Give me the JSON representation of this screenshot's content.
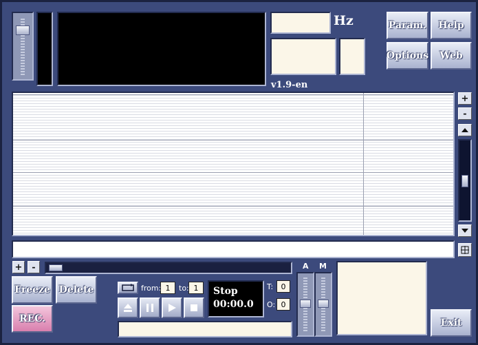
{
  "top": {
    "hz_label": "Hz",
    "version": "v1.9-en",
    "buttons": {
      "param": "Param.",
      "help": "Help",
      "options": "Options",
      "web": "Web"
    }
  },
  "side_controls": {
    "plus": "+",
    "minus": "-"
  },
  "bottom": {
    "plus": "+",
    "minus": "-",
    "freeze": "Freeze",
    "delete": "Delete",
    "rec": "REC.",
    "exit": "Exit",
    "from_label": "from:",
    "from_value": "1",
    "to_label": "to:",
    "to_value": "1",
    "status": "Stop",
    "time": "00:00.0",
    "t_label": "T:",
    "t_value": "0",
    "o_label": "O:",
    "o_value": "0",
    "a_label": "A",
    "m_label": "M"
  },
  "icons": {
    "repeat": "repeat-icon",
    "eject": "eject-icon",
    "pause": "pause-icon",
    "play": "play-icon",
    "stop": "stop-icon",
    "scroll_up": "triangle-up-icon",
    "scroll_down": "triangle-down-icon",
    "fit": "fit-view-icon"
  },
  "colors": {
    "background": "#3c4a7c",
    "panel_cream": "#fbf6e8",
    "button_gradient_top": "#e8ecf6",
    "rec_pink": "#e48ab8"
  }
}
